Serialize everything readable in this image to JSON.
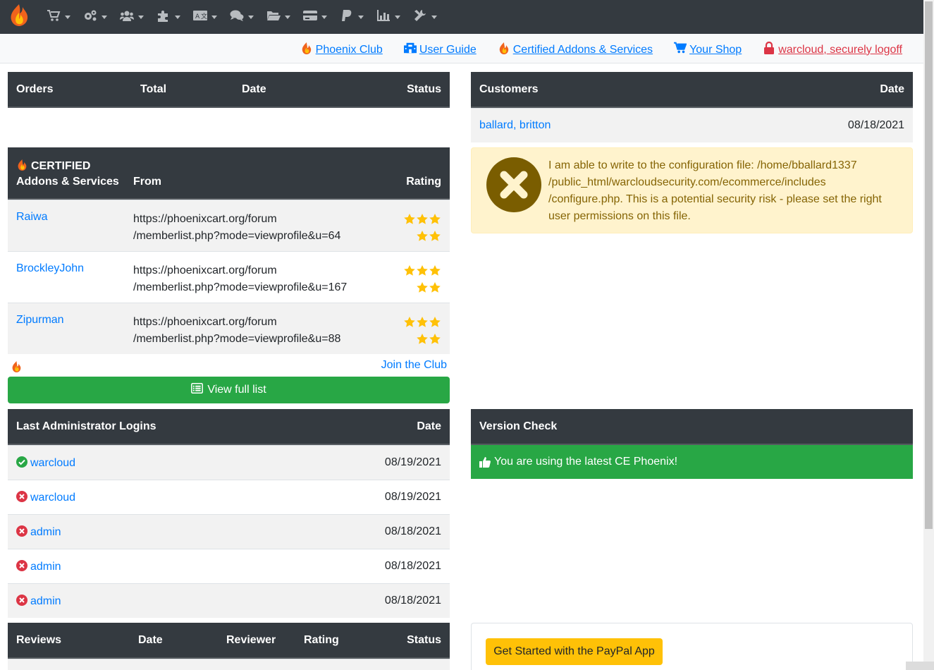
{
  "nav": {
    "logo_icon": "phoenix-logo-icon",
    "menus": [
      {
        "name": "cart-icon"
      },
      {
        "name": "cogs-icon"
      },
      {
        "name": "users-icon"
      },
      {
        "name": "puzzle-icon"
      },
      {
        "name": "language-icon"
      },
      {
        "name": "comments-icon"
      },
      {
        "name": "folder-open-icon"
      },
      {
        "name": "credit-card-icon"
      },
      {
        "name": "paypal-icon"
      },
      {
        "name": "chart-bar-icon"
      },
      {
        "name": "tools-icon"
      }
    ]
  },
  "subbar": {
    "phoenix_club": "Phoenix Club",
    "user_guide": "User Guide",
    "certified": "Certified Addons & Services",
    "your_shop": "Your Shop",
    "logoff": "warcloud, securely logoff"
  },
  "orders": {
    "headers": [
      "Orders",
      "Total",
      "Date",
      "Status"
    ]
  },
  "customers": {
    "headers": [
      "Customers",
      "Date"
    ],
    "rows": [
      {
        "name": "ballard, britton",
        "date": "08/18/2021"
      }
    ]
  },
  "config_warning": {
    "text1": "I am able to write to the configuration file: /home/bballard1337",
    "text2": "/public_html/warcloudsecurity.com/ecommerce/includes",
    "text3": "/configure.php. This is a potential security risk - please set the right",
    "text4": "user permissions on this file."
  },
  "certified": {
    "header_top": "CERTIFIED",
    "header_bottom": "Addons & Services",
    "header_from": "From",
    "header_rating": "Rating",
    "rows": [
      {
        "name": "Raiwa",
        "from1": "https://phoenixcart.org/forum",
        "from2": "/memberlist.php?mode=viewprofile&u=64",
        "rating": 5
      },
      {
        "name": "BrockleyJohn",
        "from1": "https://phoenixcart.org/forum",
        "from2": "/memberlist.php?mode=viewprofile&u=167",
        "rating": 5
      },
      {
        "name": "Zipurman",
        "from1": "https://phoenixcart.org/forum",
        "from2": "/memberlist.php?mode=viewprofile&u=88",
        "rating": 5
      }
    ],
    "join": "Join the Club",
    "view_full": "View full list"
  },
  "admin_logins": {
    "headers": [
      "Last Administrator Logins",
      "Date"
    ],
    "rows": [
      {
        "user": "warcloud",
        "date": "08/19/2021",
        "ok": true
      },
      {
        "user": "warcloud",
        "date": "08/19/2021",
        "ok": false
      },
      {
        "user": "admin",
        "date": "08/18/2021",
        "ok": false
      },
      {
        "user": "admin",
        "date": "08/18/2021",
        "ok": false
      },
      {
        "user": "admin",
        "date": "08/18/2021",
        "ok": false
      }
    ]
  },
  "version": {
    "header": "Version Check",
    "message": "You are using the latest CE Phoenix!"
  },
  "reviews": {
    "headers": [
      "Reviews",
      "Date",
      "Reviewer",
      "Rating",
      "Status"
    ]
  },
  "paypal": {
    "button": "Get Started with the PayPal App"
  },
  "colors": {
    "dark": "#343a40",
    "link": "#007bff",
    "success": "#28a745",
    "danger": "#dc3545",
    "warning_bg": "#fff3cd",
    "warning_text": "#856404",
    "star": "#ffc107"
  }
}
